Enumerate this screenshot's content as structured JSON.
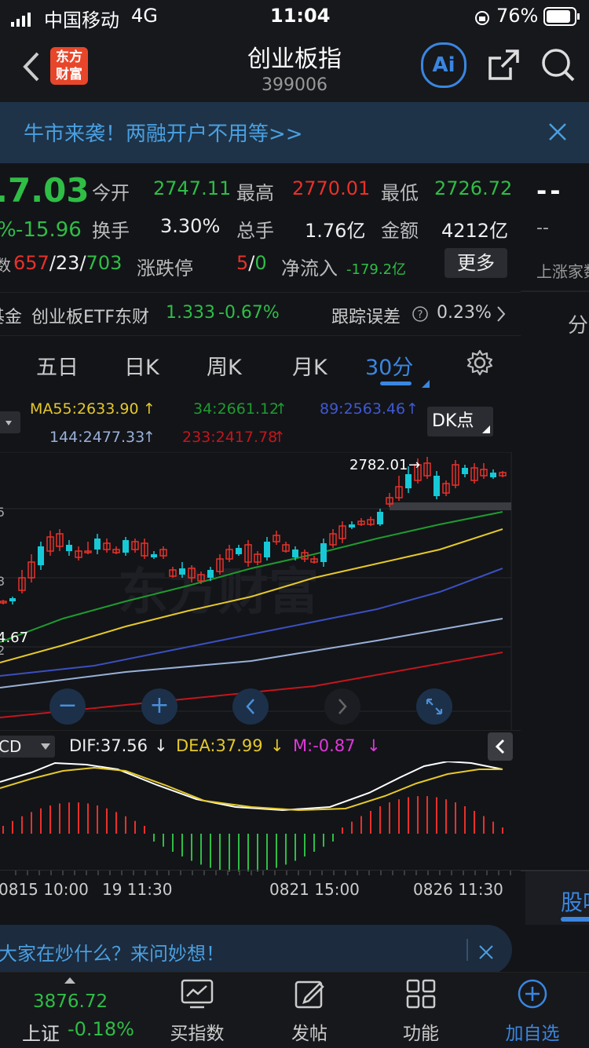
{
  "status_bar": {
    "carrier": "中国移动",
    "network": "4G",
    "time": "11:04",
    "battery": "76%"
  },
  "header": {
    "brand_line1": "东方",
    "brand_line2": "财富",
    "title": "创业板指",
    "code": "399006",
    "ai_label": "Ai"
  },
  "banner": {
    "text": "牛市来袭！两融开户不用等>>"
  },
  "quote": {
    "price": ".7.03",
    "change_pct": "%",
    "change": "-15.96",
    "open_label": "今开",
    "open": "2747.11",
    "high_label": "最高",
    "high": "2770.01",
    "low_label": "最低",
    "low": "2726.72",
    "turnover_label": "换手",
    "turnover": "3.30%",
    "volume_label": "总手",
    "volume": "1.76亿",
    "amount_label": "金额",
    "amount": "4212亿",
    "count_prefix": "数",
    "up_count": "657",
    "flat_count": "23",
    "down_count": "703",
    "limit_label": "涨跌停",
    "limit_up": "5",
    "limit_down": "0",
    "netflow_label": "净流入",
    "netflow": "-179.2亿",
    "more_label": "更多"
  },
  "right_panel": {
    "dash1": "--",
    "dash2": "--",
    "rise_label": "上涨家数",
    "fen_label": "分",
    "gu_label": "股吧"
  },
  "etf": {
    "prefix": "基金",
    "name": "创业板ETF东财",
    "price": "1.333",
    "change": "-0.67%",
    "tracking_label": "跟踪误差",
    "tracking_value": "0.23%"
  },
  "tabs": {
    "items": [
      "五日",
      "日K",
      "周K",
      "月K",
      "30分"
    ],
    "active": "30分"
  },
  "ma": {
    "ma55": "MA55:2633.90",
    "ma34": "34:2661.12",
    "ma89": "89:2563.46",
    "ma144": "144:2477.33",
    "ma233": "233:2417.78",
    "dk_label": "DK点"
  },
  "chart_labels": {
    "peak": "2782.01",
    "left_5": "5",
    "left_3": "3",
    "left_val": "4.67",
    "left_2": "2"
  },
  "watermark": "东方财富",
  "macd": {
    "name": "CD",
    "dif": "DIF:37.56",
    "dea": "DEA:37.99",
    "m": "M:-0.87"
  },
  "time_axis": [
    "0815 10:00",
    "19 11:30",
    "0821 15:00",
    "0826 11:30"
  ],
  "ai_prompt": "大家在炒什么？来问妙想！",
  "bottom_nav": {
    "index_value": "3876.72",
    "index_name": "上证",
    "index_change": "-0.18%",
    "items": [
      "买指数",
      "发帖",
      "功能",
      "加自选"
    ]
  },
  "colors": {
    "up": "#e8312a",
    "down": "#2fbd46",
    "accent": "#3a86e0",
    "ma55": "#e5c82a",
    "ma34": "#1f9b2f",
    "ma89": "#3c4fbf",
    "ma144": "#9ab0d8",
    "ma233": "#c3161d"
  }
}
